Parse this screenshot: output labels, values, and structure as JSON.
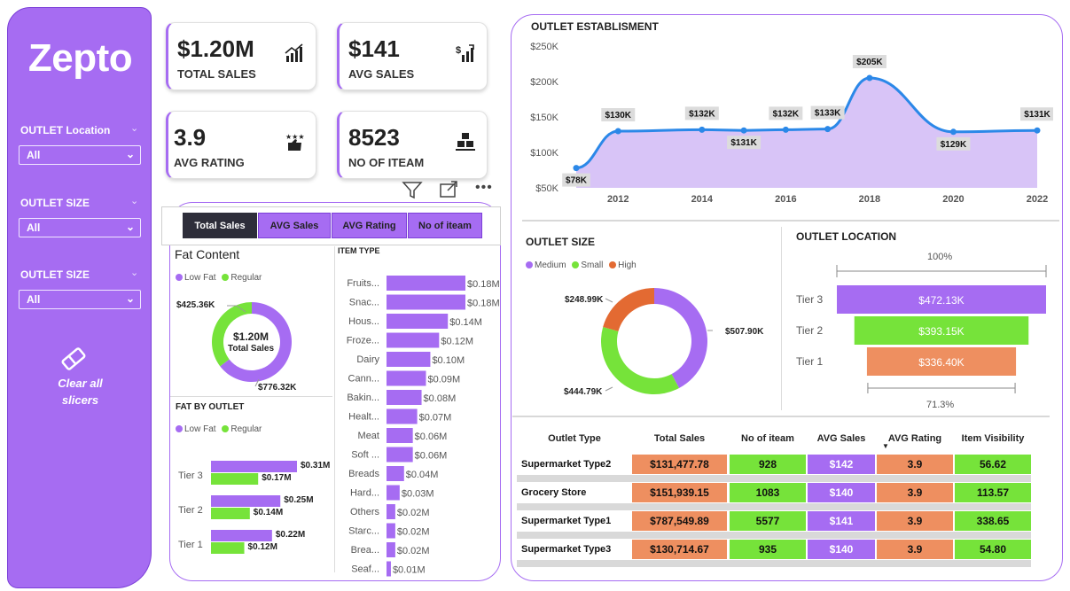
{
  "brand": "Zepto",
  "slicers": [
    {
      "label": "OUTLET Location",
      "value": "All"
    },
    {
      "label": "OUTLET SIZE",
      "value": "All"
    },
    {
      "label": "OUTLET SIZE",
      "value": "All"
    }
  ],
  "clear": {
    "line1": "Clear all",
    "line2": "slicers"
  },
  "kpis": [
    {
      "value": "$1.20M",
      "label": "TOTAL SALES",
      "icon": "chart-growth-icon"
    },
    {
      "value": "$141",
      "label": "AVG SALES",
      "icon": "dollar-bars-icon"
    },
    {
      "value": "3.9",
      "label": "AVG RATING",
      "icon": "stars-thumb-icon"
    },
    {
      "value": "8523",
      "label": "NO OF ITEAM",
      "icon": "boxes-icon"
    }
  ],
  "tabs": [
    "Total Sales",
    "AVG Sales",
    "AVG Rating",
    "No of iteam"
  ],
  "colors": {
    "purple": "#a66cf2",
    "green": "#76e33a",
    "orange": "#ee8f60",
    "orange_dark": "#e36a32",
    "light_purple": "#d8c4f7"
  },
  "fat_content": {
    "title": "Fat Content",
    "legend": [
      "Low Fat",
      "Regular"
    ],
    "center_value": "$1.20M",
    "center_label": "Total Sales",
    "low_fat_label": "$776.32K",
    "regular_label": "$425.36K",
    "chart_data": {
      "type": "pie",
      "categories": [
        "Low Fat",
        "Regular"
      ],
      "values": [
        776.32,
        425.36
      ],
      "unit": "K"
    }
  },
  "fat_by_outlet": {
    "title": "FAT BY OUTLET",
    "legend": [
      "Low Fat",
      "Regular"
    ],
    "chart_data": {
      "type": "bar",
      "categories": [
        "Tier 3",
        "Tier 2",
        "Tier 1"
      ],
      "series": [
        {
          "name": "Low Fat",
          "values": [
            0.31,
            0.25,
            0.22
          ],
          "labels": [
            "$0.31M",
            "$0.25M",
            "$0.22M"
          ]
        },
        {
          "name": "Regular",
          "values": [
            0.17,
            0.14,
            0.12
          ],
          "labels": [
            "$0.17M",
            "$0.14M",
            "$0.12M"
          ]
        }
      ]
    }
  },
  "item_type": {
    "title": "ITEM TYPE",
    "chart_data": {
      "type": "bar",
      "categories": [
        "Fruits...",
        "Snac...",
        "Hous...",
        "Froze...",
        "Dairy",
        "Cann...",
        "Bakin...",
        "Healt...",
        "Meat",
        "Soft ...",
        "Breads",
        "Hard...",
        "Others",
        "Starc...",
        "Brea...",
        "Seaf..."
      ],
      "values": [
        0.18,
        0.18,
        0.14,
        0.12,
        0.1,
        0.09,
        0.08,
        0.07,
        0.06,
        0.06,
        0.04,
        0.03,
        0.02,
        0.02,
        0.02,
        0.01
      ],
      "labels": [
        "$0.18M",
        "$0.18M",
        "$0.14M",
        "$0.12M",
        "$0.10M",
        "$0.09M",
        "$0.08M",
        "$0.07M",
        "$0.06M",
        "$0.06M",
        "$0.04M",
        "$0.03M",
        "$0.02M",
        "$0.02M",
        "$0.02M",
        "$0.01M"
      ]
    }
  },
  "establishment": {
    "title": "OUTLET ESTABLISMENT",
    "chart_data": {
      "type": "area",
      "x": [
        2011,
        2012,
        2014,
        2015,
        2016,
        2017,
        2018,
        2020,
        2022
      ],
      "values": [
        78,
        130,
        132,
        131,
        132,
        133,
        205,
        129,
        131
      ],
      "labels": [
        "$78K",
        "$130K",
        "$132K",
        "$131K",
        "$132K",
        "$133K",
        "$205K",
        "$129K",
        "$131K"
      ],
      "label_pos": [
        "below",
        "above",
        "above",
        "below",
        "above",
        "above",
        "above",
        "below",
        "above"
      ],
      "yticks": [
        "$50K",
        "$100K",
        "$150K",
        "$200K",
        "$250K"
      ],
      "ytick_values": [
        50,
        100,
        150,
        200,
        250
      ],
      "xticks": [
        "2012",
        "2014",
        "2016",
        "2018",
        "2020",
        "2022"
      ],
      "xtick_values": [
        2012,
        2014,
        2016,
        2018,
        2020,
        2022
      ],
      "ylim": [
        50,
        250
      ],
      "xlim": [
        2011,
        2022
      ]
    }
  },
  "outlet_size": {
    "title": "OUTLET SIZE",
    "legend": [
      "Medium",
      "Small",
      "High"
    ],
    "chart_data": {
      "type": "pie",
      "categories": [
        "Medium",
        "Small",
        "High"
      ],
      "values": [
        507.9,
        444.79,
        248.99
      ],
      "labels": [
        "$507.90K",
        "$444.79K",
        "$248.99K"
      ]
    }
  },
  "outlet_location": {
    "title": "OUTLET LOCATION",
    "top_pct": "100%",
    "bottom_pct": "71.3%",
    "chart_data": {
      "type": "bar",
      "categories": [
        "Tier 3",
        "Tier 2",
        "Tier 1"
      ],
      "values": [
        472.13,
        393.15,
        336.4
      ],
      "labels": [
        "$472.13K",
        "$393.15K",
        "$336.40K"
      ]
    }
  },
  "table": {
    "headers": [
      "Outlet Type",
      "Total Sales",
      "No of iteam",
      "AVG Sales",
      "AVG Rating",
      "Item Visibility"
    ],
    "rows": [
      [
        "Supermarket Type2",
        "$131,477.78",
        "928",
        "$142",
        "3.9",
        "56.62"
      ],
      [
        "Grocery Store",
        "$151,939.15",
        "1083",
        "$140",
        "3.9",
        "113.57"
      ],
      [
        "Supermarket Type1",
        "$787,549.89",
        "5577",
        "$141",
        "3.9",
        "338.65"
      ],
      [
        "Supermarket Type3",
        "$130,714.67",
        "935",
        "$140",
        "3.9",
        "54.80"
      ]
    ]
  }
}
